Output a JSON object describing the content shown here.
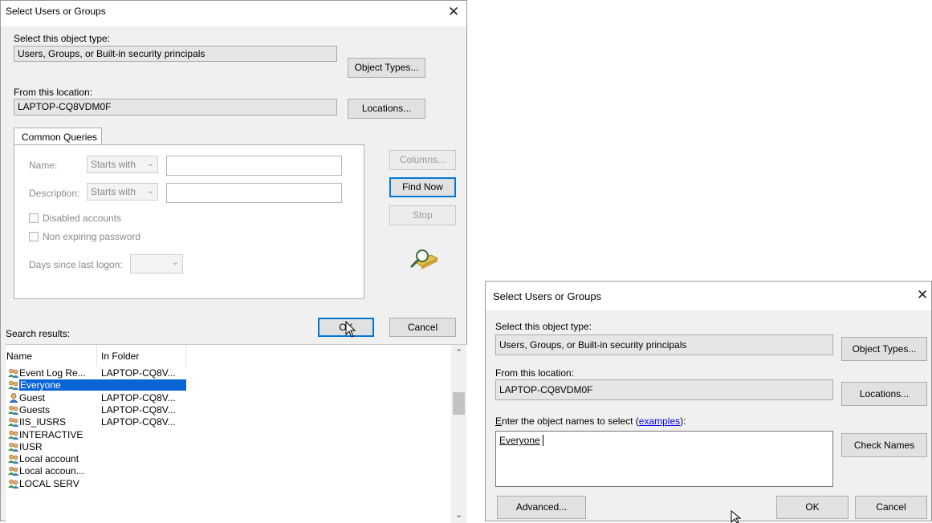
{
  "left_dialog": {
    "title": "Select Users or Groups",
    "close_glyph": "✕",
    "object_type_label": "Select this object type:",
    "object_type_value": "Users, Groups, or Built-in security principals",
    "object_types_button": "Object Types...",
    "location_label": "From this location:",
    "location_value": "LAPTOP-CQ8VDM0F",
    "locations_button": "Locations...",
    "tab_label": "Common Queries",
    "name_label": "Name:",
    "name_mode": "Starts with",
    "description_label": "Description:",
    "description_mode": "Starts with",
    "disabled_accounts_label": "Disabled accounts",
    "non_expiring_label": "Non expiring password",
    "days_label": "Days since last logon:",
    "columns_button": "Columns...",
    "find_now_button": "Find Now",
    "stop_button": "Stop",
    "ok_button": "OK",
    "cancel_button": "Cancel",
    "search_results_label": "Search results:",
    "results": {
      "columns": [
        "Name",
        "In Folder"
      ],
      "rows": [
        {
          "name": "Event Log Re...",
          "folder": "LAPTOP-CQ8V...",
          "icon": "group-icon"
        },
        {
          "name": "Everyone",
          "folder": "",
          "icon": "group-icon",
          "selected": true
        },
        {
          "name": "Guest",
          "folder": "LAPTOP-CQ8V...",
          "icon": "user-icon"
        },
        {
          "name": "Guests",
          "folder": "LAPTOP-CQ8V...",
          "icon": "group-icon"
        },
        {
          "name": "IIS_IUSRS",
          "folder": "LAPTOP-CQ8V...",
          "icon": "group-icon"
        },
        {
          "name": "INTERACTIVE",
          "folder": "",
          "icon": "group-icon"
        },
        {
          "name": "IUSR",
          "folder": "",
          "icon": "group-icon"
        },
        {
          "name": "Local account",
          "folder": "",
          "icon": "group-icon"
        },
        {
          "name": "Local accoun...",
          "folder": "",
          "icon": "group-icon"
        },
        {
          "name": "LOCAL SERV",
          "folder": "",
          "icon": "group-icon"
        }
      ]
    }
  },
  "right_dialog": {
    "title": "Select Users or Groups",
    "close_glyph": "✕",
    "object_type_label": "Select this object type:",
    "object_type_value": "Users, Groups, or Built-in security principals",
    "object_types_button": "Object Types...",
    "location_label": "From this location:",
    "location_value": "LAPTOP-CQ8VDM0F",
    "locations_button": "Locations...",
    "enter_names_prefix": "E",
    "enter_names_rest": "nter the object names to select (",
    "examples_link": "examples",
    "enter_names_suffix": "):",
    "names_value": "Everyone",
    "check_names_button": "Check Names",
    "advanced_button": "Advanced...",
    "ok_button": "OK",
    "cancel_button": "Cancel"
  },
  "colors": {
    "dialog_bg": "#f0f0f0",
    "selection": "#0a64d6",
    "default_button_border": "#0078d7",
    "link": "#0000ee"
  }
}
